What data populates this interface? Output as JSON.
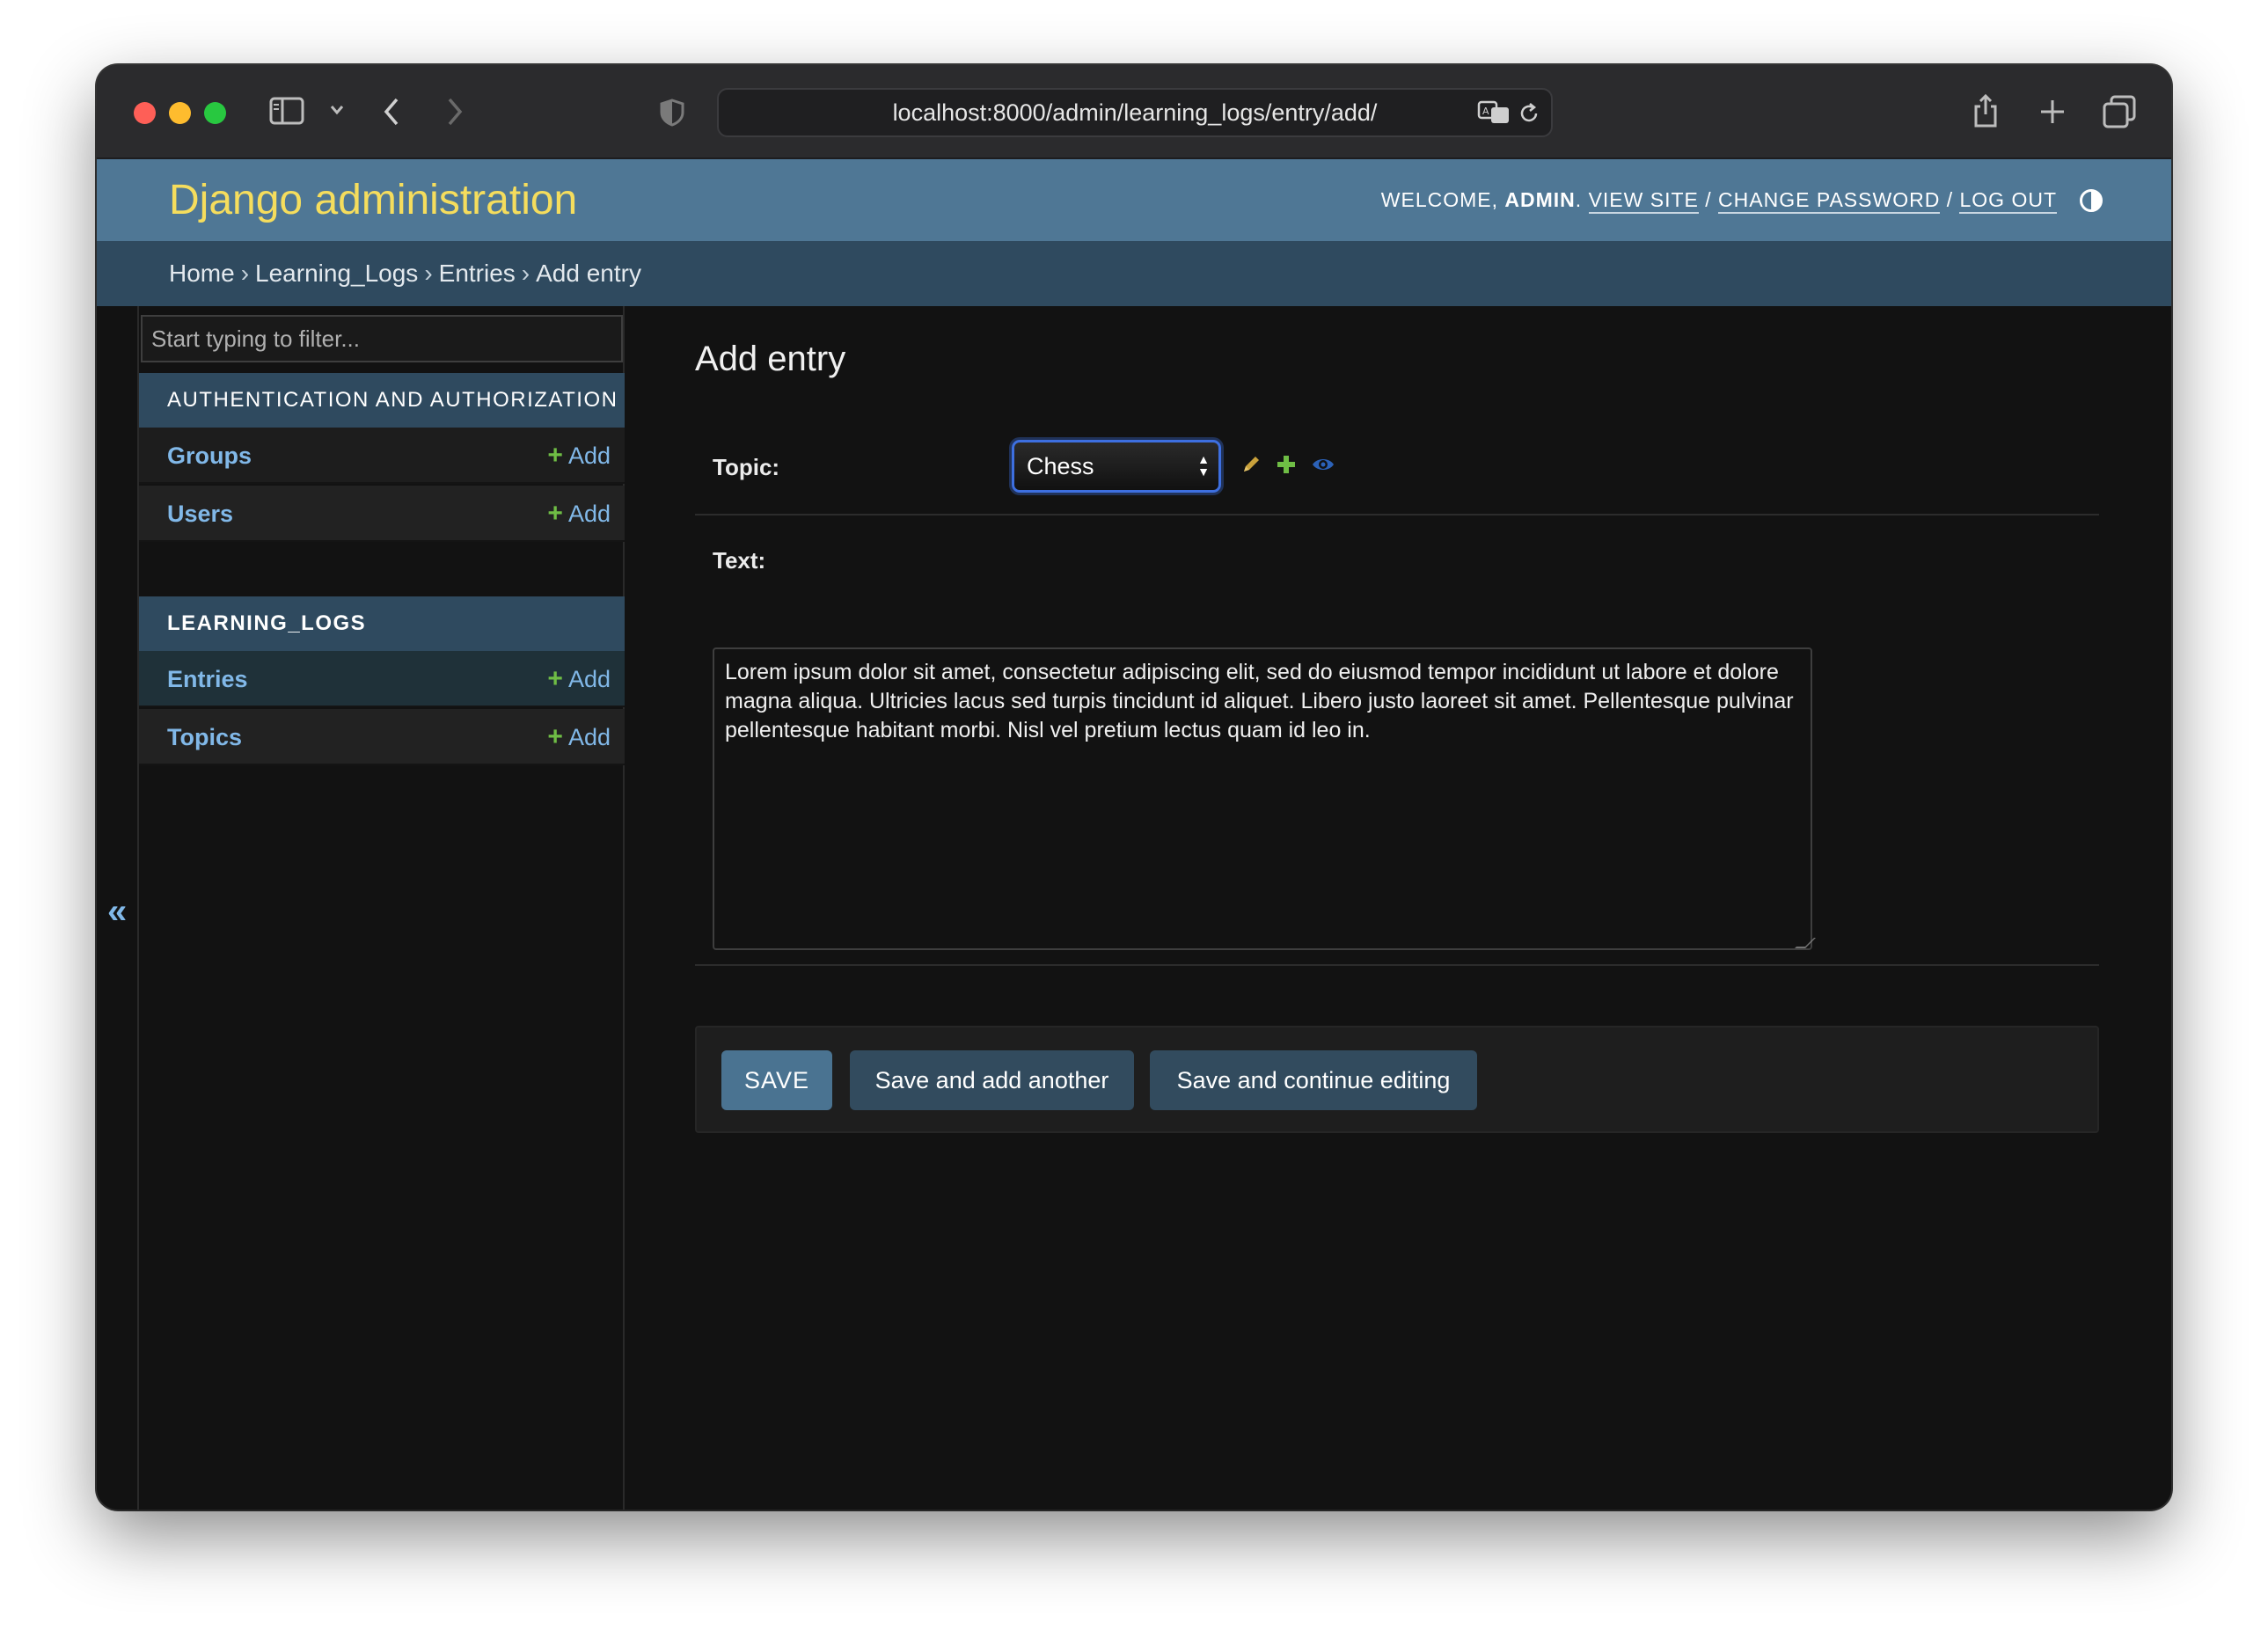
{
  "browser": {
    "url": "localhost:8000/admin/learning_logs/entry/add/"
  },
  "header": {
    "branding": "Django administration",
    "welcome": "Welcome,",
    "username": "admin",
    "view_site": "View site",
    "change_password": "Change password",
    "log_out": "Log out",
    "separator": "/"
  },
  "breadcrumbs": {
    "items": [
      "Home",
      "Learning_Logs",
      "Entries",
      "Add entry"
    ],
    "separator": "›"
  },
  "sidebar": {
    "filter_placeholder": "Start typing to filter...",
    "collapse_label": "«",
    "modules": [
      {
        "caption": "Authentication and Authorization",
        "models": [
          {
            "name": "Groups",
            "add_label": "Add"
          },
          {
            "name": "Users",
            "add_label": "Add"
          }
        ]
      },
      {
        "caption": "LEARNING_LOGS",
        "models": [
          {
            "name": "Entries",
            "add_label": "Add"
          },
          {
            "name": "Topics",
            "add_label": "Add"
          }
        ]
      }
    ]
  },
  "main": {
    "title": "Add entry",
    "fields": {
      "topic_label": "Topic:",
      "topic_value": "Chess",
      "text_label": "Text:",
      "text_value": "Lorem ipsum dolor sit amet, consectetur adipiscing elit, sed do eiusmod tempor incididunt ut labore et dolore magna aliqua. Ultricies lacus sed turpis tincidunt id aliquet. Libero justo laoreet sit amet. Pellentesque pulvinar pellentesque habitant morbi. Nisl vel pretium lectus quam id leo in."
    },
    "icons": [
      "pencil-icon",
      "plus-icon",
      "eye-icon"
    ],
    "buttons": {
      "save": "SAVE",
      "save_add_another": "Save and add another",
      "save_continue": "Save and continue editing"
    }
  },
  "colors": {
    "header_bg": "#4f7795",
    "branding": "#f5dd5d",
    "breadcrumbs_bg": "#2f4a5f",
    "link": "#81b8e8",
    "add_plus": "#6fbd45",
    "primary_button": "#4a7391",
    "secondary_button": "#324b5e"
  }
}
